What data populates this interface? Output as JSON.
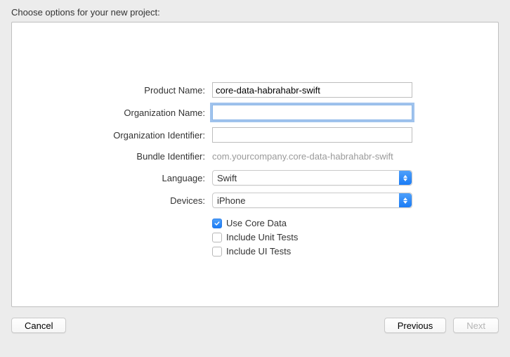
{
  "title": "Choose options for your new project:",
  "form": {
    "product_name": {
      "label": "Product Name:",
      "value": "core-data-habrahabr-swift"
    },
    "org_name": {
      "label": "Organization Name:",
      "value": ""
    },
    "org_id": {
      "label": "Organization Identifier:",
      "value": ""
    },
    "bundle_id": {
      "label": "Bundle Identifier:",
      "value": "com.yourcompany.core-data-habrahabr-swift"
    },
    "language": {
      "label": "Language:",
      "value": "Swift"
    },
    "devices": {
      "label": "Devices:",
      "value": "iPhone"
    },
    "use_core_data": {
      "label": "Use Core Data"
    },
    "include_unit_tests": {
      "label": "Include Unit Tests"
    },
    "include_ui_tests": {
      "label": "Include UI Tests"
    }
  },
  "buttons": {
    "cancel": "Cancel",
    "previous": "Previous",
    "next": "Next"
  }
}
